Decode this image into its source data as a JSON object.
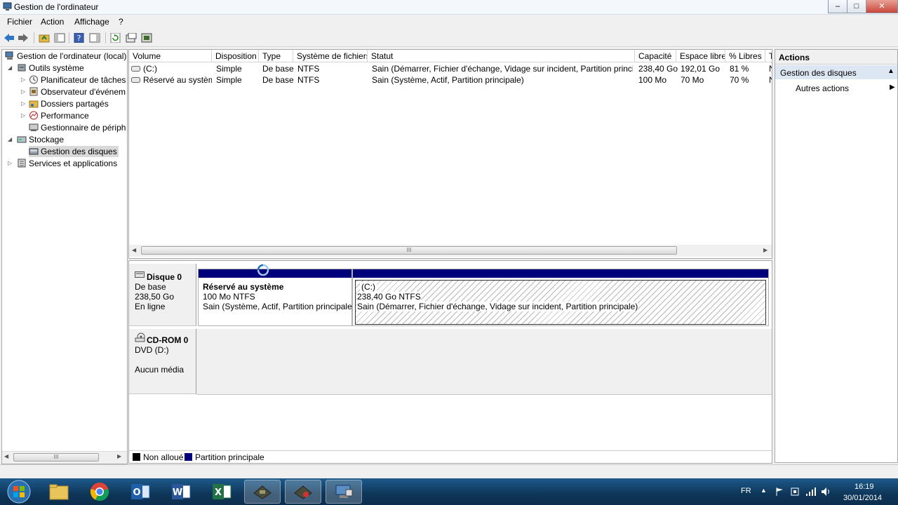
{
  "window": {
    "title": "Gestion de l'ordinateur",
    "min": "–",
    "max": "□",
    "close": "✕"
  },
  "menu": [
    "Fichier",
    "Action",
    "Affichage",
    "?"
  ],
  "tree": {
    "root": "Gestion de l'ordinateur (local)",
    "outils": "Outils système",
    "planificateur": "Planificateur de tâches",
    "observateur": "Observateur d'événements",
    "dossiers": "Dossiers partagés",
    "performance": "Performance",
    "gestionnaire": "Gestionnaire de périphériques",
    "stockage": "Stockage",
    "gestion_disques": "Gestion des disques",
    "services": "Services et applications"
  },
  "list": {
    "columns": [
      "Volume",
      "Disposition",
      "Type",
      "Système de fichiers",
      "Statut",
      "Capacité",
      "Espace libre",
      "% Libres",
      "T"
    ],
    "rows": [
      [
        "(C:)",
        "Simple",
        "De base",
        "NTFS",
        "Sain (Démarrer, Fichier d'échange, Vidage sur incident, Partition principale)",
        "238,40 Go",
        "192,01 Go",
        "81 %",
        "N"
      ],
      [
        "Réservé au système",
        "Simple",
        "De base",
        "NTFS",
        "Sain (Système, Actif, Partition principale)",
        "100 Mo",
        "70 Mo",
        "70 %",
        "N"
      ]
    ],
    "scroll_grip": "III"
  },
  "disk0": {
    "name": "Disque 0",
    "type": "De base",
    "size": "238,50 Go",
    "status": "En ligne",
    "p1": {
      "title": "Réservé au système",
      "size": "100 Mo NTFS",
      "status": "Sain (Système, Actif, Partition principale)"
    },
    "p2": {
      "title": "(C:)",
      "size": "238,40 Go NTFS",
      "status": "Sain (Démarrer, Fichier d'échange, Vidage sur incident, Partition principale)"
    }
  },
  "cdrom": {
    "name": "CD-ROM 0",
    "drive": "DVD (D:)",
    "status": "Aucun média"
  },
  "legend": {
    "unallocated": "Non alloué",
    "primary": "Partition principale"
  },
  "actions": {
    "header": "Actions",
    "section": "Gestion des disques",
    "more": "Autres actions"
  },
  "tree_scroll_grip": "III",
  "taskbar": {
    "lang": "FR",
    "time": "16:19",
    "date": "30/01/2014"
  },
  "colors": {
    "primary_partition": "#00007b",
    "unallocated": "#000000",
    "selection": "#cde1f6",
    "actions_header": "#dde7f3"
  }
}
